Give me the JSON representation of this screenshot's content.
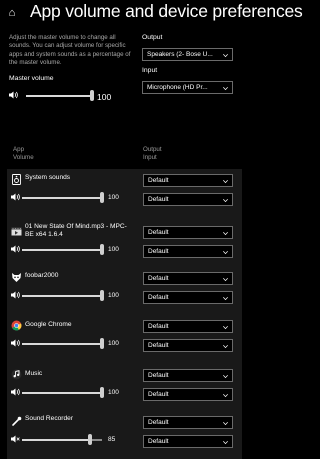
{
  "header": {
    "title": "App volume and device preferences"
  },
  "description": "Adjust the master volume to change all sounds. You can adjust volume for specific apps and system sounds as a percentage of the master volume.",
  "master_volume": {
    "label": "Master volume",
    "value": "100",
    "level": 1.0
  },
  "output": {
    "label": "Output",
    "selected": "Speakers (2- Bose U..."
  },
  "input": {
    "label": "Input",
    "selected": "Microphone (HD Pr..."
  },
  "columns": {
    "app": "App",
    "volume": "Volume",
    "output": "Output",
    "input": "Input"
  },
  "apps": [
    {
      "name": "System sounds",
      "value": "100",
      "level": 1.0,
      "output": "Default",
      "input": "Default",
      "icon": "system-sounds-icon",
      "muted": false
    },
    {
      "name": "01 New State Of Mind.mp3 - MPC-BE x64 1.6.4",
      "value": "100",
      "level": 1.0,
      "output": "Default",
      "input": "Default",
      "icon": "mpc-be-icon",
      "muted": false
    },
    {
      "name": "foobar2000",
      "value": "100",
      "level": 1.0,
      "output": "Default",
      "input": "Default",
      "icon": "foobar2000-icon",
      "muted": false
    },
    {
      "name": "Google Chrome",
      "value": "100",
      "level": 1.0,
      "output": "Default",
      "input": "Default",
      "icon": "chrome-icon",
      "muted": false
    },
    {
      "name": "Music",
      "value": "100",
      "level": 1.0,
      "output": "Default",
      "input": "Default",
      "icon": "music-icon",
      "muted": false
    },
    {
      "name": "Sound Recorder",
      "value": "85",
      "level": 0.85,
      "output": "Default",
      "input": "Default",
      "icon": "sound-recorder-icon",
      "muted": true
    }
  ]
}
